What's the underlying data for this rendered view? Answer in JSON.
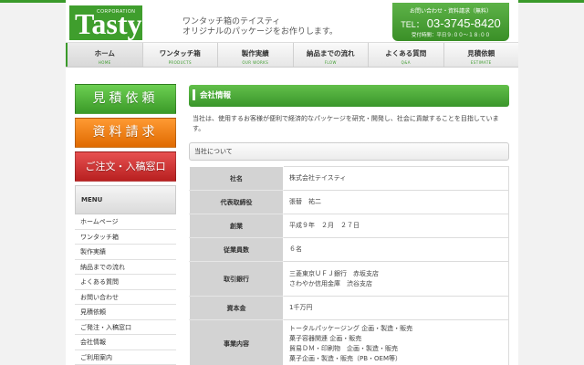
{
  "header": {
    "logo_text": "Tasty",
    "logo_corp": "CORPORATION",
    "tagline_1": "ワンタッチ箱のテイスティ",
    "tagline_2": "オリジナルのパッケージをお作りします。",
    "contact_top": "お問い合わせ・資料請求（無料）",
    "tel_label": "TEL：",
    "tel_number": "03-3745-8420",
    "hours": "受付時間：平日９:００～１８:００"
  },
  "nav": [
    {
      "jp": "ホーム",
      "en": "HOME"
    },
    {
      "jp": "ワンタッチ箱",
      "en": "PRODUCTS"
    },
    {
      "jp": "製作実績",
      "en": "OUR WORKS"
    },
    {
      "jp": "納品までの流れ",
      "en": "FLOW"
    },
    {
      "jp": "よくある質問",
      "en": "Q&A"
    },
    {
      "jp": "見積依頼",
      "en": "ESTIMATE"
    }
  ],
  "sidebar": {
    "btn_estimate": "見積依頼",
    "btn_docs": "資料請求",
    "btn_order": "ご注文・入稿窓口",
    "menu_head": "MENU",
    "menu": [
      "ホームページ",
      "ワンタッチ箱",
      "製作実績",
      "納品までの流れ",
      "よくある質問",
      "お問い合わせ",
      "見積依頼",
      "ご発注・入稿窓口",
      "会社情報",
      "ご利用案内"
    ]
  },
  "main": {
    "title": "会社情報",
    "intro": "当社は、使用するお客様が便利で経済的なパッケージを研究・開発し、社会に貢献することを目指しています。",
    "subhead": "当社について",
    "rows": {
      "name_label": "社名",
      "name_value": "株式会社テイスティ",
      "ceo_label": "代表取締役",
      "ceo_value": "張替　祐二",
      "founded_label": "創業",
      "founded_value": "平成９年　２月　２７日",
      "staff_label": "従業員数",
      "staff_value": "６名",
      "bank_label": "取引銀行",
      "bank_value_1": "三菱東京ＵＦＪ銀行　赤坂支店",
      "bank_value_2": "さわやか信用金庫　渋谷支店",
      "capital_label": "資本金",
      "capital_value": "1千万円",
      "business_label": "事業内容",
      "business_value_1": "トータルパッケージング 企画・製造・販売",
      "business_value_2": "菓子容器関連 企画・販売",
      "business_value_3": "貿易ＤＭ・印刷物　企画・製造・販売",
      "business_value_4": "菓子企画・製造・販売（PB・OEM等）"
    }
  },
  "colors": {
    "brand_green": "#3a9a2a",
    "estimate_button": "#4aad34",
    "docs_button": "#f47c10",
    "order_button": "#d03030"
  }
}
